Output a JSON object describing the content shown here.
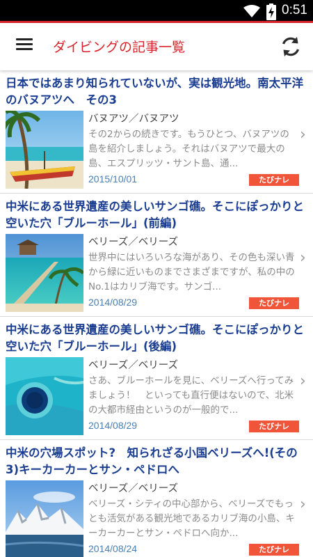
{
  "status": {
    "time": "0:51"
  },
  "header": {
    "title": "ダイビングの記事一覧"
  },
  "articles": [
    {
      "title": "日本ではあまり知られていないが、実は観光地。南太平洋のバヌアツへ　その3",
      "location": "バヌアツ／バヌアツ",
      "excerpt": "その2からの続きです。もうひとつ、バヌアツの島を紹介しましょう。それはバヌアツで最大の島、エスプリッツ・サント島、通...",
      "date": "2015/10/01",
      "badge": "たびナレ"
    },
    {
      "title": "中米にある世界遺産の美しいサンゴ礁。そこにぽっかりと空いた穴「ブルーホール」(前編)",
      "location": "ベリーズ／ベリーズ",
      "excerpt": "世界中にはいろいろな海があり、その色も深い青から緑に近いものまでさまざまですが、私の中のNo.1はカリブ海です。サンゴ...",
      "date": "2014/08/29",
      "badge": "たびナレ"
    },
    {
      "title": "中米にある世界遺産の美しいサンゴ礁。そこにぽっかりと空いた穴「ブルーホール」(後編)",
      "location": "ベリーズ／ベリーズ",
      "excerpt": "さあ、ブルーホールを見に、ベリーズへ行ってみましょう！　といっても直行便はないので、北米の大都市経由というのが一般的で...",
      "date": "2014/08/29",
      "badge": "たびナレ"
    },
    {
      "title": "中米の穴場スポット?　知られざる小国ベリーズへ!(その3)キーカーカーとサン・ペドロへ",
      "location": "ベリーズ／ベリーズ",
      "excerpt": "ベリーズ・シティの中心部から、ベリーズでもっとも活気がある観光地であるカリブ海の小島、キーカーカーとサン・ペドロへ向か...",
      "date": "2014/08/24",
      "badge": "たびナレ"
    }
  ],
  "colors": {
    "accent": "#d8232a",
    "headline": "#1a3d91",
    "badge": "#f0553a",
    "date": "#4a7fb5"
  },
  "icons": [
    "wifi-icon",
    "battery-charging-icon",
    "menu-icon",
    "refresh-icon",
    "chevron-right-icon"
  ]
}
